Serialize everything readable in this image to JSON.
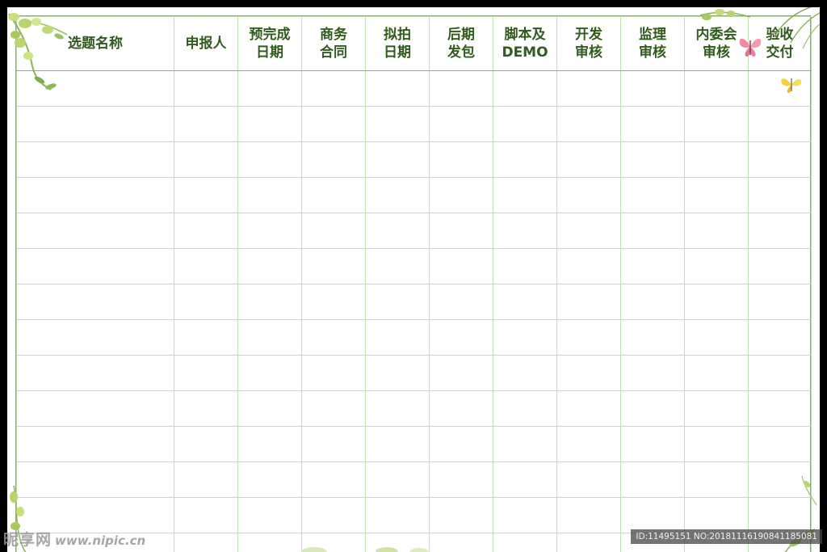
{
  "table": {
    "columns": [
      {
        "lines": [
          "选题名称"
        ]
      },
      {
        "lines": [
          "申报人"
        ]
      },
      {
        "lines": [
          "预完成",
          "日期"
        ]
      },
      {
        "lines": [
          "商务",
          "合同"
        ]
      },
      {
        "lines": [
          "拟拍",
          "日期"
        ]
      },
      {
        "lines": [
          "后期",
          "发包"
        ]
      },
      {
        "lines": [
          "脚本及",
          "DEMO"
        ]
      },
      {
        "lines": [
          "开发",
          "审核"
        ]
      },
      {
        "lines": [
          "监理",
          "审核"
        ]
      },
      {
        "lines": [
          "内委会",
          "审核"
        ]
      },
      {
        "lines": [
          "验收",
          "交付"
        ]
      }
    ],
    "empty_rows": 14
  },
  "watermark": {
    "logo_text": "昵享网",
    "url_text": "www.nipic.cn",
    "id_text": "ID:11495151 NO:20181116190841185081"
  },
  "colors": {
    "header_text": "#2f5c1c",
    "grid_line": "#bfe0b0",
    "frame_line": "#7fae69",
    "background": "#000000"
  }
}
